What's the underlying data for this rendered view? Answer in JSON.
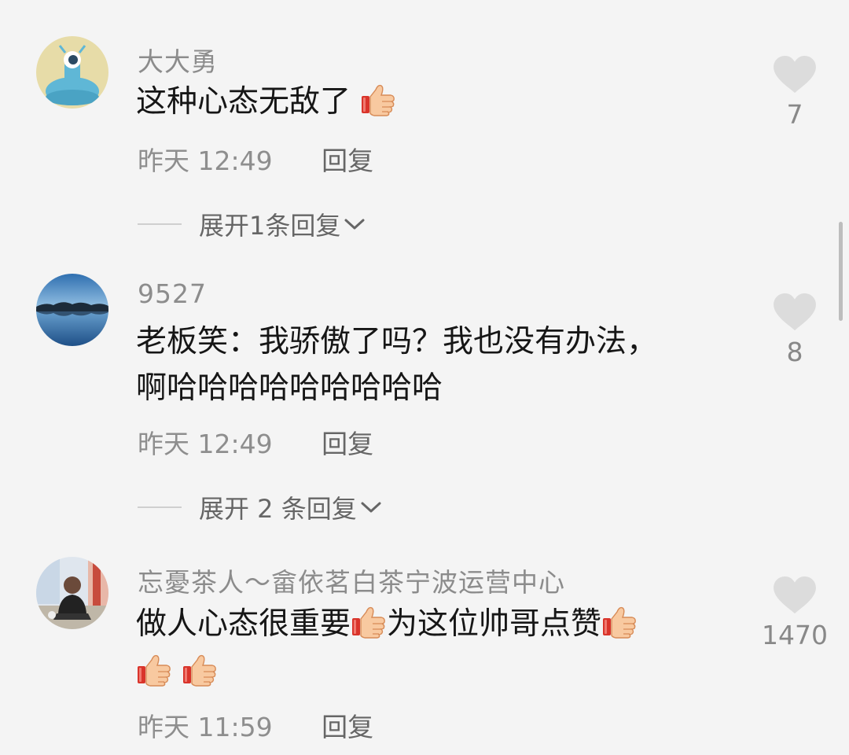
{
  "comments": [
    {
      "username": "大大勇",
      "text_lines": [
        "这种心态无敌了"
      ],
      "emoji_after_text": "thumbs-up",
      "time": "昨天 12:49",
      "reply_label": "回复",
      "likes": "7",
      "expand_label": "展开1条回复"
    },
    {
      "username": "9527",
      "text_lines": [
        "老板笑：我骄傲了吗？我也没有办法，",
        "啊哈哈哈哈哈哈哈哈哈"
      ],
      "time": "昨天 12:49",
      "reply_label": "回复",
      "likes": "8",
      "expand_label": "展开 2 条回复"
    },
    {
      "username": "忘憂茶人～畲依茗白茶宁波运营中心",
      "text_part1": "做人心态很重要",
      "text_part2": "为这位帅哥点赞",
      "time": "昨天 11:59",
      "reply_label": "回复",
      "likes": "1470"
    }
  ],
  "colors": {
    "background": "#f4f4f4",
    "heart": "#dcdcdc",
    "meta_text": "#8e8e8e"
  }
}
